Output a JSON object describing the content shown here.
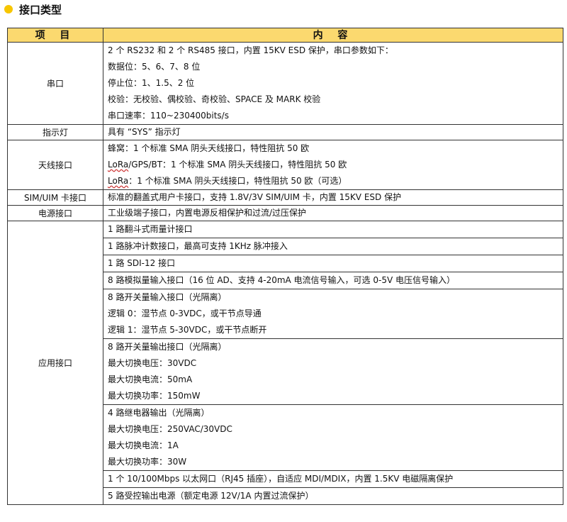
{
  "heading": "接口类型",
  "header": {
    "item": "项 目",
    "content": "内 容"
  },
  "serial": {
    "label": "串口",
    "lines": [
      "2 个 RS232 和 2 个 RS485 接口，内置 15KV ESD 保护，串口参数如下：",
      "数据位：5、6、7、8 位",
      "停止位：1、1.5、2 位",
      "校验：无校验、偶校验、奇校验、SPACE 及 MARK 校验",
      "串口速率：110~230400bits/s"
    ]
  },
  "indicator": {
    "label": "指示灯",
    "text": "具有 “SYS” 指示灯"
  },
  "antenna": {
    "label": "天线接口",
    "lines": [
      "蜂窝：1 个标准 SMA 阴头天线接口，特性阻抗 50 欧",
      {
        "prefix": "LoRa",
        "rest": "/GPS/BT：1 个标准 SMA 阴头天线接口，特性阻抗 50 欧"
      },
      {
        "prefix": "LoRa",
        "rest": "：1 个标准 SMA 阴头天线接口，特性阻抗 50 欧（可选）"
      }
    ]
  },
  "sim": {
    "label": "SIM/UIM 卡接口",
    "text": "标准的翻盖式用户卡接口，支持 1.8V/3V SIM/UIM  卡，内置 15KV ESD  保护"
  },
  "power": {
    "label": "电源接口",
    "text": "工业级端子接口，内置电源反相保护和过流/过压保护"
  },
  "application": {
    "label": "应用接口",
    "rows": [
      [
        "1 路翻斗式雨量计接口"
      ],
      [
        "1 路脉冲计数接口，最高可支持 1KHz 脉冲接入"
      ],
      [
        "1 路 SDI-12 接口"
      ],
      [
        "8 路模拟量输入接口（16 位 AD、支持 4-20mA 电流信号输入，可选 0-5V 电压信号输入）"
      ],
      [
        "8 路开关量输入接口（光隔离）",
        "逻辑 0：湿节点 0-3VDC，或干节点导通",
        "逻辑 1：湿节点 5-30VDC，或干节点断开"
      ],
      [
        "8 路开关量输出接口（光隔离）",
        "最大切换电压：30VDC",
        "最大切换电流：50mA",
        "最大切换功率：150mW"
      ],
      [
        "4 路继电器输出（光隔离）",
        "最大切换电压：250VAC/30VDC",
        "最大切换电流：1A",
        "最大切换功率：30W"
      ],
      [
        "1 个 10/100Mbps 以太网口（RJ45 插座），自适应 MDI/MDIX，内置 1.5KV 电磁隔离保护"
      ],
      [
        "5 路受控输出电源（额定电源 12V/1A 内置过流保护）"
      ]
    ]
  }
}
